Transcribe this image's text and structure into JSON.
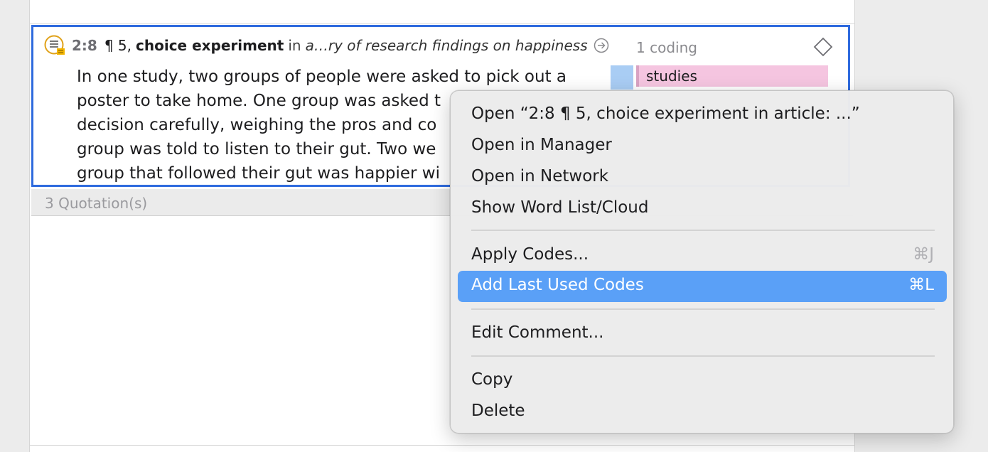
{
  "quotation": {
    "id": "2:8",
    "paragraph": "¶ 5,",
    "name": "choice experiment",
    "in_word": "in",
    "document": "a…ry of research findings on happiness",
    "lines": [
      "In one study, two groups of people were asked to pick out a",
      "poster to take home. One group was asked t",
      "decision carefully, weighing the pros and co",
      "group was told to listen to their gut. Two we",
      "group that followed their gut was happier wi"
    ],
    "coding_count": "1 coding",
    "code": {
      "label": "studies",
      "color": "#f5c5e0",
      "swatch": "#a9cdf4"
    }
  },
  "footer": {
    "label": "3 Quotation(s)"
  },
  "context_menu": {
    "items": [
      {
        "label": "Open “2:8  ¶ 5, choice experiment in article: ...”"
      },
      {
        "label": "Open in Manager"
      },
      {
        "label": "Open in Network"
      },
      {
        "label": "Show Word List/Cloud"
      },
      {
        "label": "Apply Codes...",
        "shortcut": "⌘J"
      },
      {
        "label": "Add Last Used Codes",
        "shortcut": "⌘L",
        "highlighted": true
      },
      {
        "label": "Edit Comment..."
      },
      {
        "label": "Copy"
      },
      {
        "label": "Delete"
      }
    ]
  },
  "colors": {
    "selection_border": "#2f6bde",
    "menu_highlight": "#5aa0f7"
  },
  "icons": [
    "quotation-comment-icon",
    "go-to-document-icon",
    "diamond-icon"
  ]
}
